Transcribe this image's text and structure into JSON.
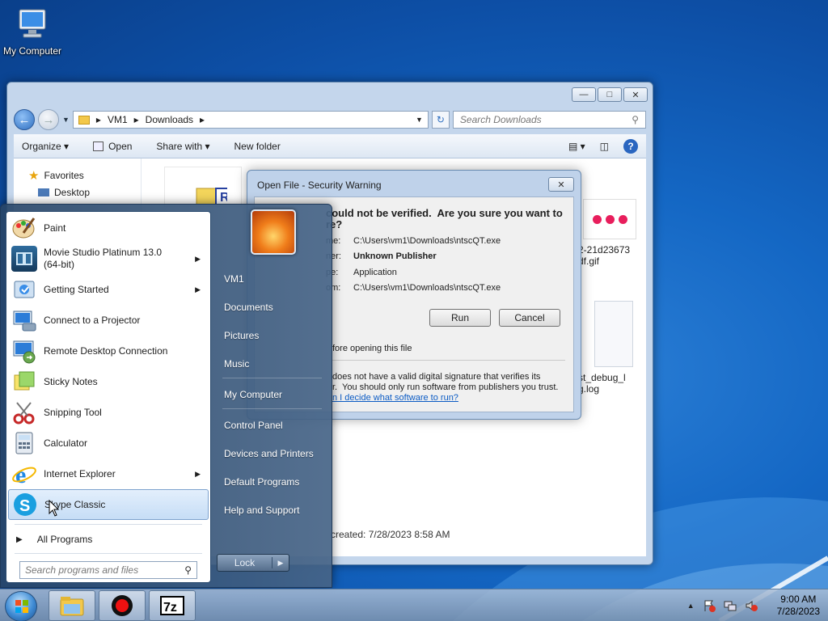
{
  "desktop": {
    "icon_label": "My Computer"
  },
  "explorer": {
    "breadcrumb": [
      "VM1",
      "Downloads"
    ],
    "search_placeholder": "Search Downloads",
    "toolbar": {
      "organize": "Organize",
      "open": "Open",
      "share_with": "Share with",
      "new_folder": "New folder"
    },
    "nav": {
      "favorites": "Favorites",
      "desktop": "Desktop"
    },
    "files": [
      {
        "name": "2-21d23673\ndf.gif"
      },
      {
        "name": "st_debug_l\ng.log"
      }
    ],
    "status_created": "created:  7/28/2023 8:58 AM"
  },
  "dialog": {
    "title": "Open File - Security Warning",
    "heading": "could not be verified.  Are you sure you want to\nre?",
    "rows": [
      {
        "key": "me:",
        "value": "C:\\Users\\vm1\\Downloads\\ntscQT.exe"
      },
      {
        "key": "ner:",
        "value": "Unknown Publisher"
      },
      {
        "key": "pe:",
        "value": "Application"
      },
      {
        "key": "om:",
        "value": "C:\\Users\\vm1\\Downloads\\ntscQT.exe"
      }
    ],
    "run": "Run",
    "cancel": "Cancel",
    "checkbox_text": "fore opening this file",
    "footer": "does not have a valid digital signature that verifies its\nr.  You should only run software from publishers you trust.",
    "link": "n I decide what software to run?"
  },
  "start_menu": {
    "programs": [
      {
        "label": "Paint",
        "icon": "paint-icon"
      },
      {
        "label": "Movie Studio Platinum 13.0\n(64-bit)",
        "icon": "movie-studio-icon",
        "submenu": true
      },
      {
        "label": "Getting Started",
        "icon": "getting-started-icon",
        "submenu": true
      },
      {
        "label": "Connect to a Projector",
        "icon": "projector-icon"
      },
      {
        "label": "Remote Desktop Connection",
        "icon": "remote-desktop-icon"
      },
      {
        "label": "Sticky Notes",
        "icon": "sticky-notes-icon"
      },
      {
        "label": "Snipping Tool",
        "icon": "snipping-tool-icon"
      },
      {
        "label": "Calculator",
        "icon": "calculator-icon"
      },
      {
        "label": "Internet Explorer",
        "icon": "internet-explorer-icon",
        "submenu": true
      },
      {
        "label": "Skype Classic",
        "icon": "skype-icon"
      }
    ],
    "all_programs": "All Programs",
    "search_placeholder": "Search programs and files",
    "right_links": [
      "VM1",
      "Documents",
      "Pictures",
      "Music",
      "My Computer",
      "Control Panel",
      "Devices and Printers",
      "Default Programs",
      "Help and Support"
    ],
    "lock": "Lock"
  },
  "taskbar": {
    "time": "9:00 AM",
    "date": "7/28/2023"
  }
}
